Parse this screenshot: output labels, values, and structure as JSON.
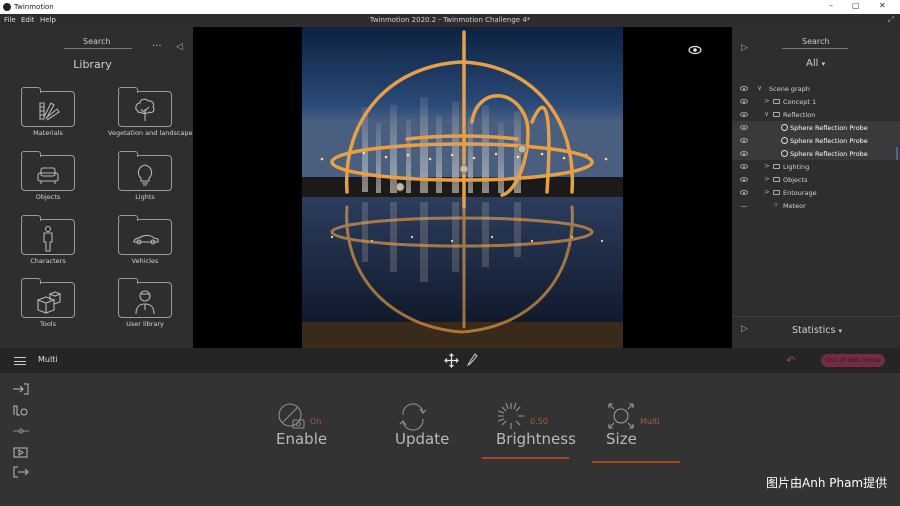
{
  "titlebar": {
    "app_name": "Twinmotion",
    "minimize": "–",
    "maximize": "▢",
    "close": "✕"
  },
  "menubar": {
    "items": [
      "File",
      "Edit",
      "Help"
    ],
    "document_title": "Twinmotion 2020.2 - Twinmotion Challenge 4*"
  },
  "library": {
    "search_label": "Search",
    "title": "Library",
    "tiles": [
      {
        "label": "Materials",
        "icon": "fan-deck-icon"
      },
      {
        "label": "Vegetation and landscape",
        "icon": "tree-icon"
      },
      {
        "label": "Objects",
        "icon": "sofa-icon"
      },
      {
        "label": "Lights",
        "icon": "bulb-icon"
      },
      {
        "label": "Characters",
        "icon": "person-icon"
      },
      {
        "label": "Vehicles",
        "icon": "car-icon"
      },
      {
        "label": "Tools",
        "icon": "cubes-icon"
      },
      {
        "label": "User library",
        "icon": "user-icon"
      }
    ]
  },
  "scene": {
    "search_label": "Search",
    "filter_label": "All",
    "tree": [
      {
        "label": "Scene graph",
        "depth": 0,
        "toggle": "∨",
        "selected": false,
        "type": "root"
      },
      {
        "label": "Concept 1",
        "depth": 1,
        "toggle": ">",
        "selected": false,
        "type": "folder"
      },
      {
        "label": "Reflection",
        "depth": 1,
        "toggle": "∨",
        "selected": false,
        "type": "folder"
      },
      {
        "label": "Sphere Reflection Probe",
        "depth": 2,
        "toggle": "",
        "selected": true,
        "type": "probe"
      },
      {
        "label": "Sphere Reflection Probe",
        "depth": 2,
        "toggle": "",
        "selected": true,
        "type": "probe"
      },
      {
        "label": "Sphere Reflection Probe",
        "depth": 2,
        "toggle": "",
        "selected": true,
        "type": "probe"
      },
      {
        "label": "Lighting",
        "depth": 1,
        "toggle": ">",
        "selected": false,
        "type": "folder"
      },
      {
        "label": "Objects",
        "depth": 1,
        "toggle": ">",
        "selected": false,
        "type": "folder"
      },
      {
        "label": "Entourage",
        "depth": 1,
        "toggle": ">",
        "selected": false,
        "type": "folder"
      },
      {
        "label": "Meteor",
        "depth": 1,
        "toggle": "",
        "selected": false,
        "type": "item"
      }
    ],
    "statistics_label": "Statistics"
  },
  "toolbar": {
    "mode_label": "Multi",
    "pill_label": "Out of edit mode"
  },
  "properties": [
    {
      "label": "Enable",
      "value": "On",
      "icon": "camera-disable-icon",
      "active": false
    },
    {
      "label": "Update",
      "value": "",
      "icon": "refresh-icon",
      "active": false
    },
    {
      "label": "Brightness",
      "value": "0.50",
      "icon": "sun-burst-icon",
      "active": true
    },
    {
      "label": "Size",
      "value": "Multi",
      "icon": "resize-sphere-icon",
      "active": true
    }
  ],
  "watermark": "图片由Anh Pham提供",
  "colors": {
    "accent": "#a0492d",
    "panel": "#2e2e2e",
    "viewport": "#000000",
    "pill": "#6e2e45"
  }
}
